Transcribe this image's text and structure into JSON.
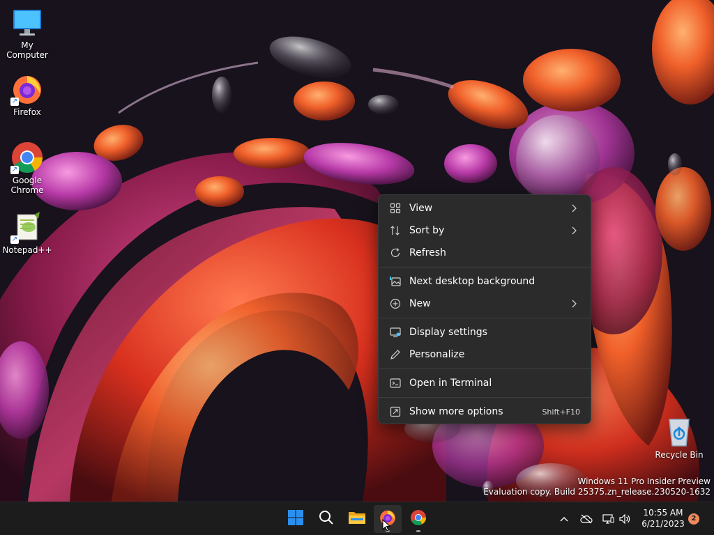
{
  "desktop": {
    "icons": [
      {
        "label": "My Computer",
        "icon": "monitor-icon"
      },
      {
        "label": "Firefox",
        "icon": "firefox-icon"
      },
      {
        "label": "Google Chrome",
        "icon": "chrome-icon"
      },
      {
        "label": "Notepad++",
        "icon": "notepad-plus-plus-icon"
      },
      {
        "label": "Recycle Bin",
        "icon": "recycle-bin-icon"
      }
    ]
  },
  "context_menu": {
    "items": [
      {
        "label": "View",
        "icon": "grid-view-icon",
        "submenu": true
      },
      {
        "label": "Sort by",
        "icon": "sort-icon",
        "submenu": true
      },
      {
        "label": "Refresh",
        "icon": "refresh-icon",
        "submenu": false
      },
      {
        "label": "Next desktop background",
        "icon": "next-background-icon",
        "submenu": false
      },
      {
        "label": "New",
        "icon": "plus-circle-icon",
        "submenu": true
      },
      {
        "label": "Display settings",
        "icon": "display-settings-icon",
        "submenu": false
      },
      {
        "label": "Personalize",
        "icon": "pen-icon",
        "submenu": false
      },
      {
        "label": "Open in Terminal",
        "icon": "terminal-icon",
        "submenu": false
      },
      {
        "label": "Show more options",
        "icon": "more-options-icon",
        "submenu": false,
        "shortcut": "Shift+F10"
      }
    ]
  },
  "watermark": {
    "line1": "Windows 11 Pro Insider Preview",
    "line2": "Evaluation copy. Build 25375.zn_release.230520-1632"
  },
  "taskbar": {
    "pinned": [
      {
        "name": "start",
        "icon": "windows-start-icon"
      },
      {
        "name": "search",
        "icon": "search-icon"
      },
      {
        "name": "file-explorer",
        "icon": "folder-icon"
      },
      {
        "name": "firefox",
        "icon": "firefox-icon",
        "active": true
      },
      {
        "name": "chrome",
        "icon": "chrome-icon",
        "running": true
      }
    ],
    "tray": {
      "icons": [
        "chevron-up-icon",
        "onedrive-offline-icon",
        "network-icon",
        "volume-icon"
      ]
    },
    "clock": {
      "time": "10:55 AM",
      "date": "6/21/2023"
    },
    "notifications": "2"
  },
  "colors": {
    "menu_bg": "#2b2b2b",
    "taskbar_bg": "#1c1c1c",
    "windows_blue": "#2b8ff0",
    "badge": "#ef8a5c"
  }
}
